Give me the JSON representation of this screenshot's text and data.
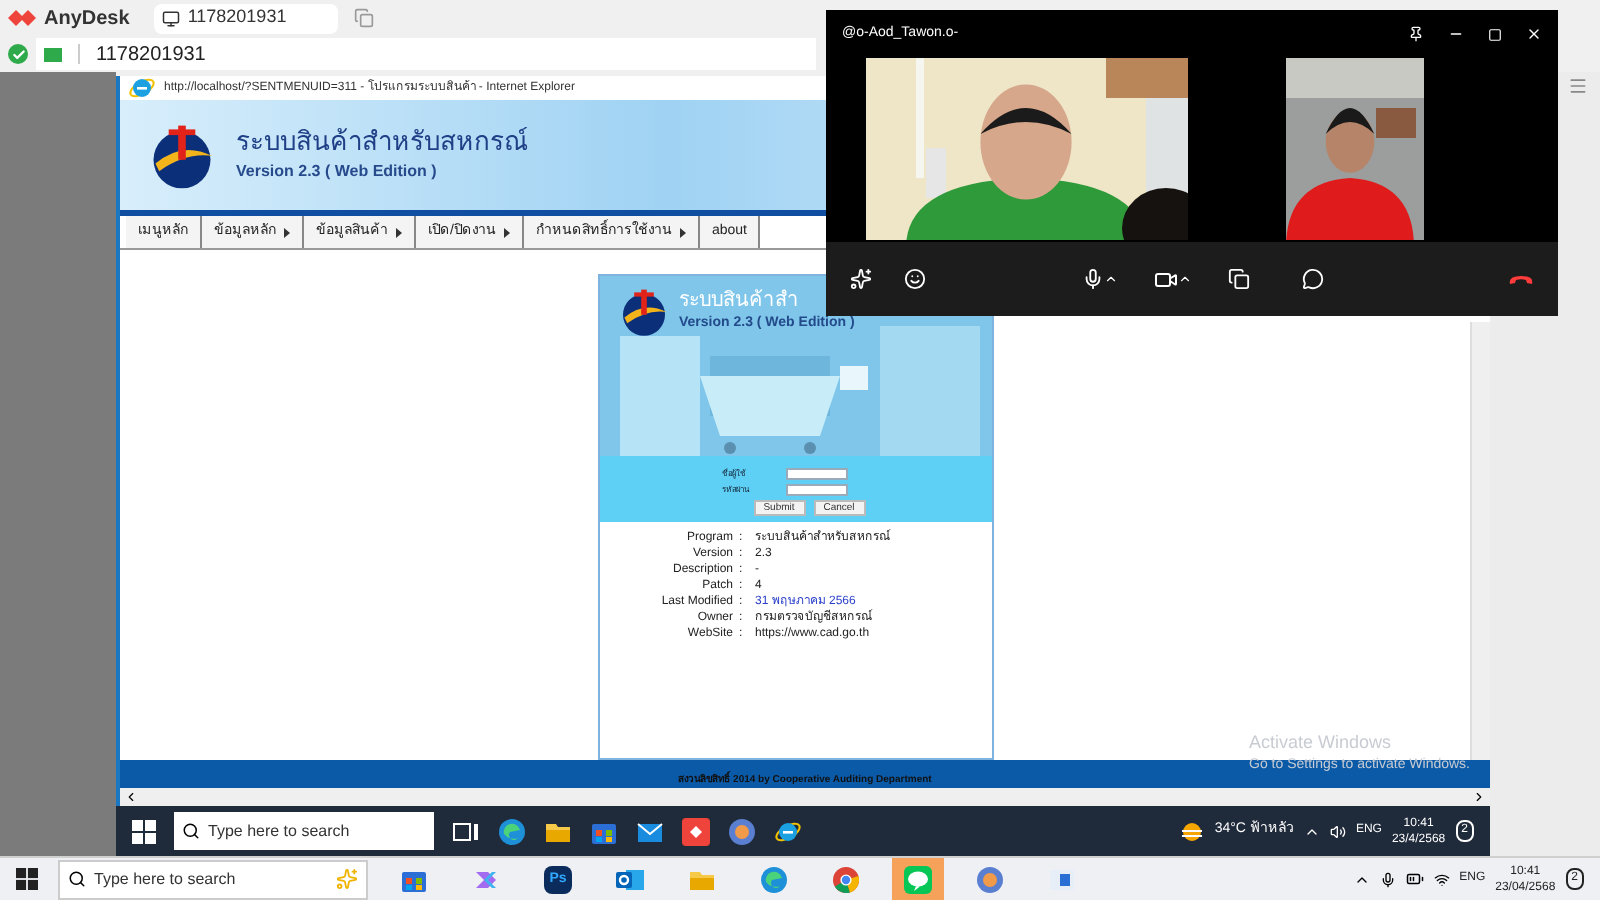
{
  "anydesk": {
    "app_name": "AnyDesk",
    "tab": "1178201931",
    "address": "1178201931"
  },
  "browser": {
    "title": "http://localhost/?SENTMENUID=311 - โปรแกรมระบบสินค้า - Internet Explorer",
    "banner": {
      "title": "ระบบสินค้าสำหรับสหกรณ์",
      "subtitle": "Version 2.3 ( Web Edition )"
    },
    "menu": [
      {
        "label": "เมนูหลัก",
        "has_submenu": false
      },
      {
        "label": "ข้อมูลหลัก",
        "has_submenu": true
      },
      {
        "label": "ข้อมูลสินค้า",
        "has_submenu": true
      },
      {
        "label": "เปิด/ปิดงาน",
        "has_submenu": true
      },
      {
        "label": "กำหนดสิทธิ์การใช้งาน",
        "has_submenu": true
      },
      {
        "label": "about",
        "has_submenu": false
      }
    ],
    "login_card": {
      "banner_title": "ระบบสินค้าสำ",
      "banner_subtitle": "Version 2.3 ( Web Edition )",
      "fields": [
        {
          "label": "ชื่อผู้ใช้"
        },
        {
          "label": "รหัสผ่าน"
        }
      ],
      "buttons": [
        "Submit",
        "Cancel"
      ],
      "info": [
        {
          "label": "Program",
          "separator": ":",
          "value": "ระบบสินค้าสำหรับสหกรณ์",
          "link": false
        },
        {
          "label": "Version",
          "separator": ":",
          "value": "2.3",
          "link": false
        },
        {
          "label": "Description",
          "separator": ":",
          "value": "-",
          "link": false
        },
        {
          "label": "Patch",
          "separator": ":",
          "value": "4",
          "link": false
        },
        {
          "label": "Last Modified",
          "separator": ":",
          "value": "31 พฤษภาคม 2566",
          "link": true
        },
        {
          "label": "Owner",
          "separator": ":",
          "value": "กรมตรวจบัญชีสหกรณ์",
          "link": false
        },
        {
          "label": "WebSite",
          "separator": ":",
          "value": "https://www.cad.go.th",
          "link": false
        }
      ]
    },
    "footer": "สงวนลิขสิทธิ์ 2014 by Cooperative Auditing Department"
  },
  "activation_notice": {
    "title": "Activate Windows",
    "text": "Go to Settings to activate Windows."
  },
  "call_window": {
    "title": "@o-Aod_Tawon.o-"
  },
  "remote_taskbar": {
    "search_placeholder": "Type here to search",
    "apps": [
      {
        "kind": "taskview"
      },
      {
        "kind": "edge"
      },
      {
        "kind": "folder"
      },
      {
        "kind": "store"
      },
      {
        "kind": "mail"
      },
      {
        "kind": "anydesk"
      },
      {
        "kind": "globe"
      },
      {
        "kind": "ie"
      }
    ],
    "weather": "34°C ฟ้าหลัว",
    "language": "ENG",
    "time": "10:41",
    "date": "23/4/2568",
    "notifications": "2"
  },
  "local_taskbar": {
    "search_placeholder": "Type here to search",
    "apps": [
      {
        "kind": "store",
        "selected": false
      },
      {
        "kind": "copilot",
        "selected": false
      },
      {
        "kind": "photoshop",
        "label": "Ps",
        "selected": false
      },
      {
        "kind": "outlook",
        "selected": false
      },
      {
        "kind": "folder",
        "selected": false
      },
      {
        "kind": "edge",
        "selected": false
      },
      {
        "kind": "chrome",
        "selected": false
      },
      {
        "kind": "line",
        "selected": true
      },
      {
        "kind": "globe",
        "selected": false
      },
      {
        "kind": "window",
        "selected": false
      }
    ],
    "language": "ENG",
    "time": "10:41",
    "date": "23/04/2568",
    "notifications": "2"
  }
}
